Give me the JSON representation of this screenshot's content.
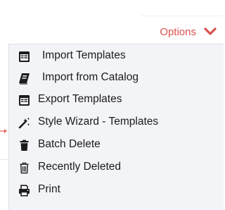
{
  "toolbar": {
    "options_label": "Options",
    "options_icon": "chevron-down-icon"
  },
  "menu": {
    "items": [
      {
        "label": "Import Templates",
        "icon": "template-icon"
      },
      {
        "label": "Import from Catalog",
        "icon": "catalog-icon"
      },
      {
        "label": "Export Templates",
        "icon": "template-icon"
      },
      {
        "label": "Style Wizard - Templates",
        "icon": "magic-wand-icon"
      },
      {
        "label": "Batch Delete",
        "icon": "trash-icon"
      },
      {
        "label": "Recently Deleted",
        "icon": "trash-outline-icon"
      },
      {
        "label": "Print",
        "icon": "printer-icon"
      }
    ]
  },
  "colors": {
    "accent": "#d9534f",
    "menu_background": "#f3f4f8",
    "text": "#1b1b1b",
    "arrow": "#e8605c"
  }
}
